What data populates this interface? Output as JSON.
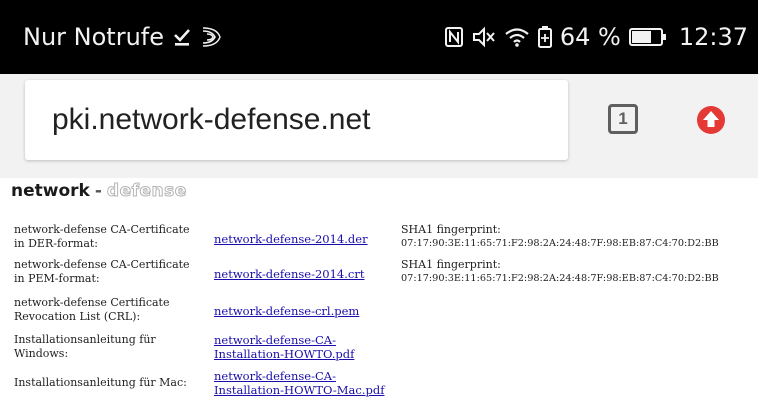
{
  "status_bar": {
    "carrier": "Nur Notrufe",
    "battery_percent": "64 %",
    "time": "12:37",
    "left_icons": [
      "check-download-icon",
      "signal-waves-icon"
    ],
    "right_icons": [
      "nfc-icon",
      "mute-icon",
      "wifi-icon",
      "battery-saver-icon",
      "battery-icon"
    ]
  },
  "toolbar": {
    "url": "pki.network-defense.net",
    "tab_count": "1",
    "update_icon": "update-arrow-icon",
    "accent_color": "#e53935"
  },
  "page": {
    "logo": {
      "part1": "network",
      "dash": "-",
      "part2": "defense"
    },
    "rows": [
      {
        "desc_lines": [
          "network-defense CA-Certificate",
          "in DER-format:"
        ],
        "link_lines": [
          "network-defense-2014.der"
        ],
        "fingerprint_label": "SHA1 fingerprint:",
        "fingerprint_value": "07:17:90:3E:11:65:71:F2:98:2A:24:48:7F:98:EB:87:C4:70:D2:BB"
      },
      {
        "desc_lines": [
          "network-defense CA-Certificate",
          "in PEM-format:"
        ],
        "link_lines": [
          "network-defense-2014.crt"
        ],
        "fingerprint_label": "SHA1 fingerprint:",
        "fingerprint_value": "07:17:90:3E:11:65:71:F2:98:2A:24:48:7F:98:EB:87:C4:70:D2:BB"
      },
      {
        "desc_lines": [
          "network-defense Certificate",
          "Revocation List (CRL):"
        ],
        "link_lines": [
          "network-defense-crl.pem"
        ]
      },
      {
        "desc_lines": [
          "Installationsanleitung für",
          "Windows:"
        ],
        "link_lines": [
          "network-defense-CA-",
          "Installation-HOWTO.pdf"
        ]
      },
      {
        "desc_lines": [
          "Installationsanleitung für Mac:"
        ],
        "link_lines": [
          "network-defense-CA-",
          "Installation-HOWTO-Mac.pdf"
        ]
      }
    ]
  }
}
